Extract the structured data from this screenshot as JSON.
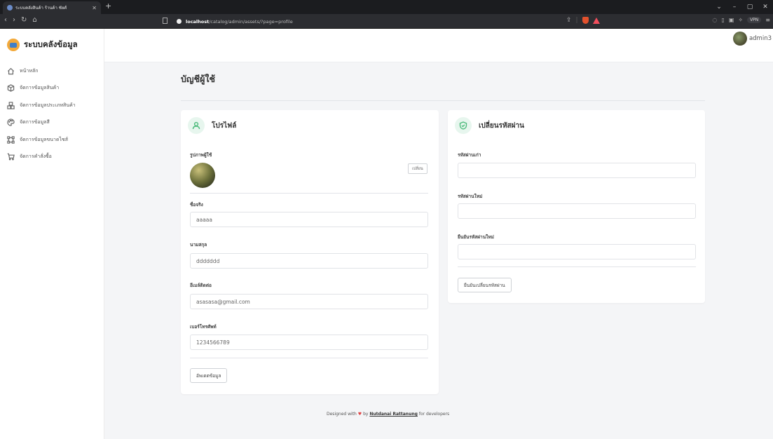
{
  "browser": {
    "tab_title": "ระบบคลังสินค้า ร้านค้า ชัยศ์",
    "new_tab": "+",
    "url_host": "localhost",
    "url_path": "/catalog/admin/assets/?page=profile",
    "vpn": "VPN",
    "window_controls": [
      "⌄",
      "–",
      "▢",
      "✕"
    ]
  },
  "sidebar": {
    "brand": "ระบบคลังข้อมูล",
    "items": [
      {
        "label": "หน้าหลัก",
        "icon": "home-icon"
      },
      {
        "label": "จัดการข้อมูลสินค้า",
        "icon": "box-icon"
      },
      {
        "label": "จัดการข้อมูลประเภทสินค้า",
        "icon": "boxes-icon"
      },
      {
        "label": "จัดการข้อมูลสี",
        "icon": "palette-icon"
      },
      {
        "label": "จัดการข้อมูลขนาดไซส์",
        "icon": "size-icon"
      },
      {
        "label": "จัดการคำสั่งซื้อ",
        "icon": "cart-icon"
      }
    ]
  },
  "topbar": {
    "username": "admin3"
  },
  "page": {
    "title": "บัญชีผู้ใช้"
  },
  "profile": {
    "title": "โปรไฟล์",
    "avatar_label": "รูปภาพผู้ใช้",
    "change_button": "เปลี่ยน",
    "first_name_label": "ชื่อจริง",
    "first_name": "aaaaa",
    "last_name_label": "นามสกุล",
    "last_name": "ddddddd",
    "email_label": "อีเมล์ติดต่อ",
    "email": "asasasa@gmail.com",
    "phone_label": "เบอร์โทรศัพท์",
    "phone": "1234566789",
    "update_button": "อัพเดตข้อมูล"
  },
  "password": {
    "title": "เปลี่ยนรหัสผ่าน",
    "old_label": "รหัสผ่านเก่า",
    "new_label": "รหัสผ่านใหม่",
    "confirm_label": "ยืนยันรหัสผ่านใหม่",
    "submit_button": "ยืนยันเปลี่ยนรหัสผ่าน"
  },
  "footer": {
    "prefix": "Designed with",
    "by": "by",
    "author": "Nutdanai Rattanung",
    "suffix": "for developers"
  },
  "colors": {
    "accent_green": "#4dbb7c",
    "heart": "#e04040"
  }
}
